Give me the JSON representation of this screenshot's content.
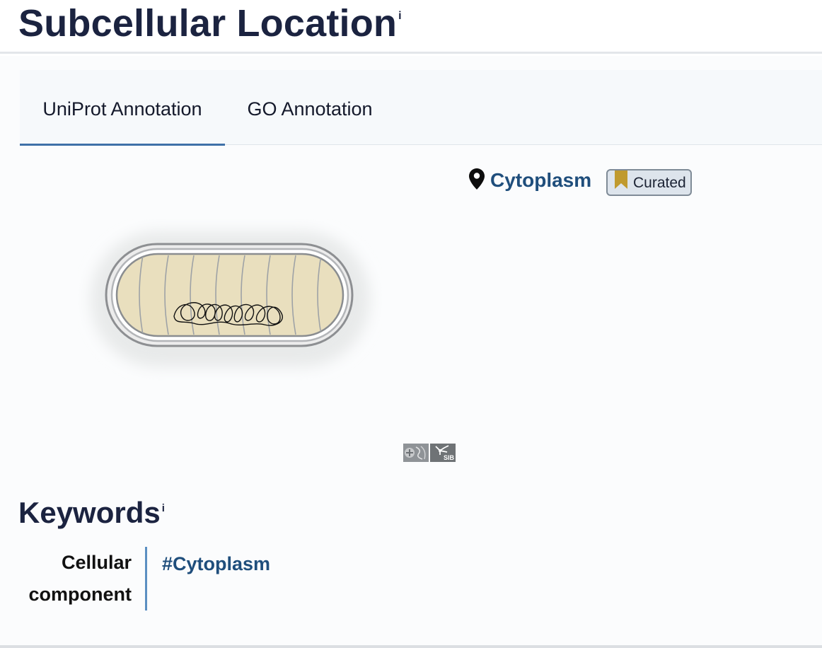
{
  "header": {
    "title": "Subcellular Location",
    "info_marker": "i"
  },
  "tabs": [
    {
      "label": "UniProt Annotation",
      "active": true
    },
    {
      "label": "GO Annotation",
      "active": false
    }
  ],
  "location": {
    "icon": "map-pin-icon",
    "name": "Cytoplasm",
    "badge": {
      "label": "Curated",
      "icon": "bookmark-icon",
      "icon_color": "#c09a2e"
    }
  },
  "figure": {
    "description_icon": "bacterial-cell-illustration",
    "logos": [
      {
        "icon": "swissbiopics-logo"
      },
      {
        "icon": "sib-logo",
        "label": "SIB"
      }
    ]
  },
  "keywords": {
    "title": "Keywords",
    "info_marker": "i",
    "items": [
      {
        "category": "Cellular component",
        "value": "#Cytoplasm"
      }
    ]
  },
  "colors": {
    "heading": "#1b2340",
    "link": "#1f4e7c",
    "tab_active_underline": "#3f71a8",
    "divider": "#5b8fc2",
    "cytoplasm_fill": "#e9dfbe"
  }
}
